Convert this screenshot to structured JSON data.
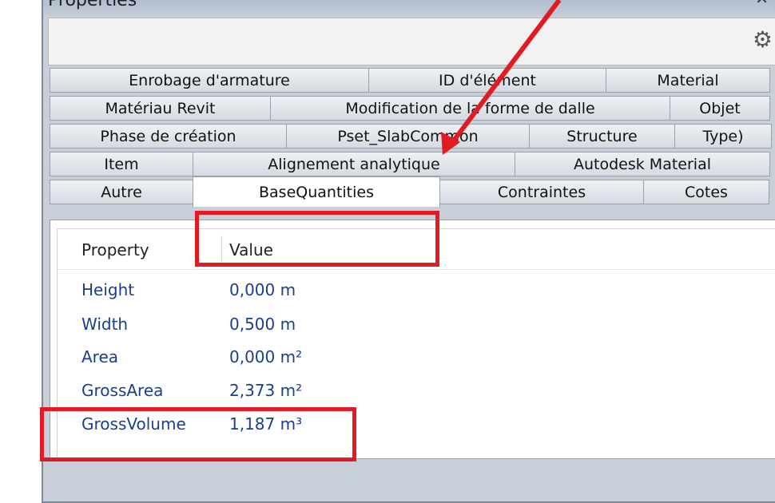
{
  "window": {
    "title": "Properties"
  },
  "tab_rows": [
    [
      {
        "label": "Enrobage d'armature",
        "w": 400
      },
      {
        "label": "ID d'élément",
        "w": 298
      },
      {
        "label": "Material",
        "w": 206
      }
    ],
    [
      {
        "label": "Matériau Revit",
        "w": 277
      },
      {
        "label": "Modification de la forme de dalle",
        "w": 501
      },
      {
        "label": "Objet",
        "w": 126
      }
    ],
    [
      {
        "label": "Phase de création",
        "w": 297
      },
      {
        "label": "Pset_SlabCommon",
        "w": 305
      },
      {
        "label": "Structure",
        "w": 183
      },
      {
        "label": "Type)",
        "w": 122
      }
    ],
    [
      {
        "label": "Item",
        "w": 180
      },
      {
        "label": "Alignement analytique",
        "w": 404
      },
      {
        "label": "Autodesk Material",
        "w": 320
      }
    ],
    [
      {
        "label": "Autre",
        "w": 180
      },
      {
        "label": "BaseQuantities",
        "w": 310,
        "active": true
      },
      {
        "label": "Contraintes",
        "w": 256
      },
      {
        "label": "Cotes",
        "w": 158
      }
    ]
  ],
  "table": {
    "headers": {
      "property": "Property",
      "value": "Value"
    },
    "rows": [
      {
        "property": "Height",
        "value": "0,000 m"
      },
      {
        "property": "Width",
        "value": "0,500 m"
      },
      {
        "property": "Area",
        "value": "0,000 m²"
      },
      {
        "property": "GrossArea",
        "value": "2,373 m²"
      },
      {
        "property": "GrossVolume",
        "value": "1,187 m³"
      }
    ]
  },
  "annotation": {
    "color": "#e11b22"
  }
}
